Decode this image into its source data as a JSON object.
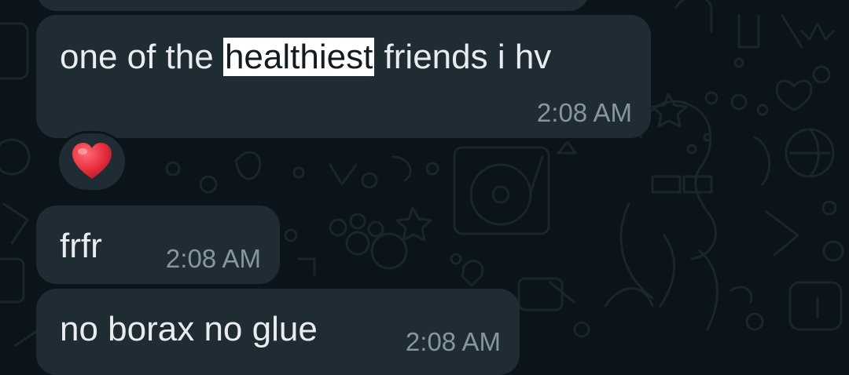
{
  "messages": [
    {
      "text_before": "one of the ",
      "highlight": "healthiest",
      "text_after": " friends i hv",
      "time": "2:08 AM",
      "reaction": "heart-emoji"
    },
    {
      "text": "frfr",
      "time": "2:08 AM"
    },
    {
      "text": "no borax no glue",
      "time": "2:08 AM"
    }
  ],
  "colors": {
    "background": "#0b141a",
    "bubble": "#1f2c34",
    "text": "#e9edef",
    "timestamp": "#8696a0",
    "highlight": "#ffffff",
    "reaction_heart": "#e8303f"
  }
}
